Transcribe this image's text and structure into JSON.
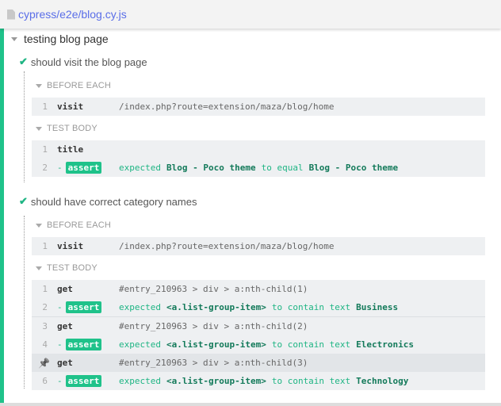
{
  "header": {
    "file_path": "cypress/e2e/blog.cy.js",
    "file_icon": "file-icon"
  },
  "suite": {
    "title": "testing blog page"
  },
  "tests": [
    {
      "title": "should visit the blog page",
      "status": "passed",
      "before_each": {
        "label": "BEFORE EACH",
        "rows": [
          {
            "num": "1",
            "cmd": "visit",
            "msg": "/index.php?route=extension/maza/blog/home"
          }
        ]
      },
      "test_body": {
        "label": "TEST BODY",
        "rows": [
          {
            "num": "1",
            "cmd": "title",
            "msg": ""
          },
          {
            "num": "2",
            "cmd": "assert",
            "prefix": "-",
            "expected": "expected",
            "subject": "Blog - Poco theme",
            "verb": "to equal",
            "value": "Blog - Poco theme"
          }
        ]
      }
    },
    {
      "title": "should have correct category names",
      "status": "passed",
      "before_each": {
        "label": "BEFORE EACH",
        "rows": [
          {
            "num": "1",
            "cmd": "visit",
            "msg": "/index.php?route=extension/maza/blog/home"
          }
        ]
      },
      "test_body": {
        "label": "TEST BODY",
        "rows": [
          {
            "num": "1",
            "cmd": "get",
            "msg": "#entry_210963 > div > a:nth-child(1)"
          },
          {
            "num": "2",
            "cmd": "assert",
            "prefix": "-",
            "expected": "expected",
            "subject": "<a.list-group-item>",
            "verb": "to contain text",
            "value": "Business"
          },
          {
            "num": "3",
            "cmd": "get",
            "msg": "#entry_210963 > div > a:nth-child(2)"
          },
          {
            "num": "4",
            "cmd": "assert",
            "prefix": "-",
            "expected": "expected",
            "subject": "<a.list-group-item>",
            "verb": "to contain text",
            "value": "Electronics"
          },
          {
            "num": "",
            "pinned": true,
            "cmd": "get",
            "msg": "#entry_210963 > div > a:nth-child(3)"
          },
          {
            "num": "6",
            "cmd": "assert",
            "prefix": "-",
            "expected": "expected",
            "subject": "<a.list-group-item>",
            "verb": "to contain text",
            "value": "Technology"
          }
        ]
      }
    }
  ],
  "colors": {
    "passed": "#1fc28a",
    "link": "#5a6ee8"
  }
}
